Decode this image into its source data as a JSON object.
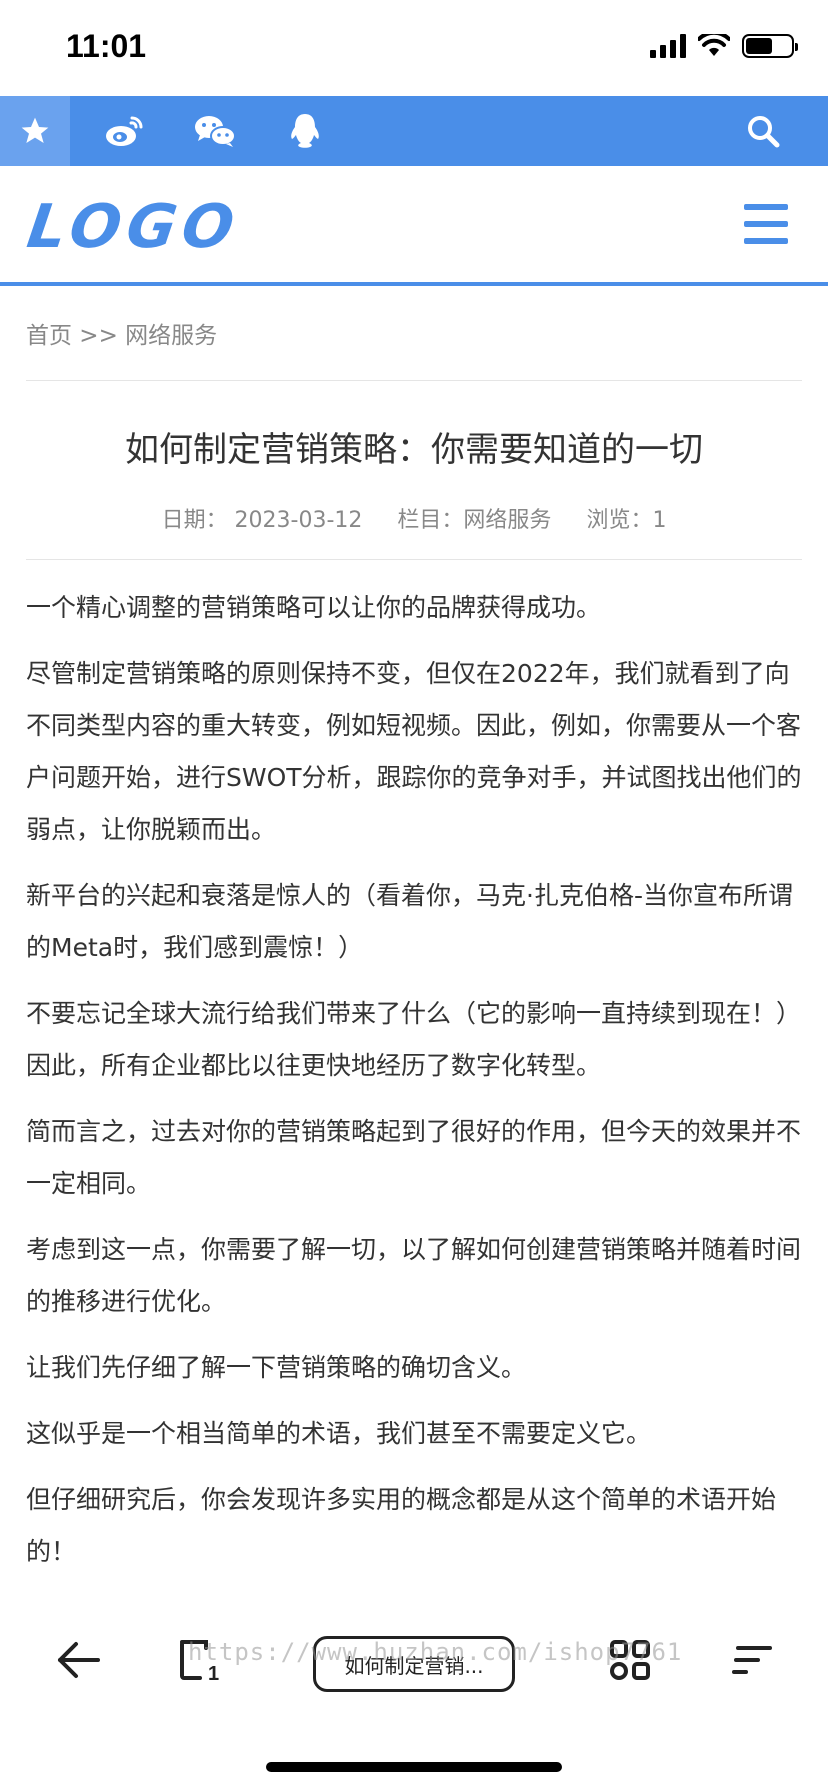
{
  "status_bar": {
    "time": "11:01",
    "battery_level": 0.6
  },
  "topbar": {
    "background": "#4a8ee8",
    "icons": [
      "star-icon",
      "weibo-icon",
      "wechat-icon",
      "qq-icon",
      "search-icon"
    ]
  },
  "header": {
    "logo": "LOGO",
    "accent": "#4a8ee8"
  },
  "breadcrumb": "首页 >> 网络服务",
  "article": {
    "title": "如何制定营销策略：你需要知道的一切",
    "meta": {
      "date": "日期： 2023-03-12",
      "category": "栏目：网络服务",
      "views": "浏览：1"
    },
    "paragraphs": [
      "一个精心调整的营销策略可以让你的品牌获得成功。",
      "尽管制定营销策略的原则保持不变，但仅在2022年，我们就看到了向不同类型内容的重大转变，例如短视频。因此，例如，你需要从一个客户问题开始，进行SWOT分析，跟踪你的竞争对手，并试图找出他们的弱点，让你脱颖而出。",
      "新平台的兴起和衰落是惊人的（看着你，马克·扎克伯格-当你宣布所谓的Meta时，我们感到震惊！）",
      "不要忘记全球大流行给我们带来了什么（它的影响一直持续到现在！）因此，所有企业都比以往更快地经历了数字化转型。",
      "简而言之，过去对你的营销策略起到了很好的作用，但今天的效果并不一定相同。",
      "考虑到这一点，你需要了解一切，以了解如何创建营销策略并随着时间的推移进行优化。",
      "让我们先仔细了解一下营销策略的确切含义。",
      "这似乎是一个相当简单的术语，我们甚至不需要定义它。",
      "但仔细研究后，你会发现许多实用的概念都是从这个简单的术语开始的！"
    ]
  },
  "bottom_bar": {
    "center_label": "如何制定营销...",
    "watermark": "https://www.huzhan.com/ishop7761",
    "icons": [
      "back-arrow-icon",
      "tabs-icon",
      "apps-icon",
      "more-icon"
    ]
  }
}
